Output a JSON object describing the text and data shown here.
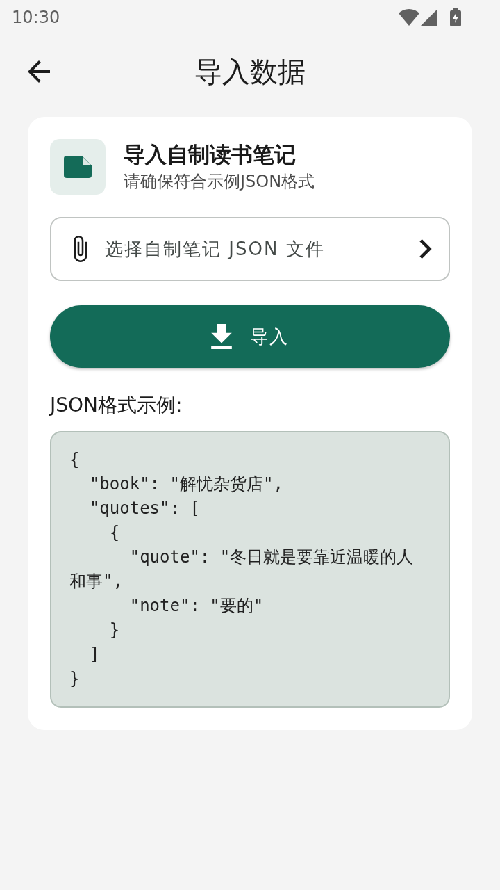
{
  "status_bar": {
    "time": "10:30"
  },
  "app_bar": {
    "title": "导入数据"
  },
  "card": {
    "title": "导入自制读书笔记",
    "subtitle": "请确保符合示例JSON格式",
    "file_picker": {
      "label": "选择自制笔记 JSON 文件"
    },
    "import_button": {
      "label": "导入"
    },
    "example_label": "JSON格式示例:",
    "example_code": "{\n  \"book\": \"解忧杂货店\",\n  \"quotes\": [\n    {\n      \"quote\": \"冬日就是要靠近温暖的人和事\",\n      \"note\": \"要的\"\n    }\n  ]\n}"
  }
}
